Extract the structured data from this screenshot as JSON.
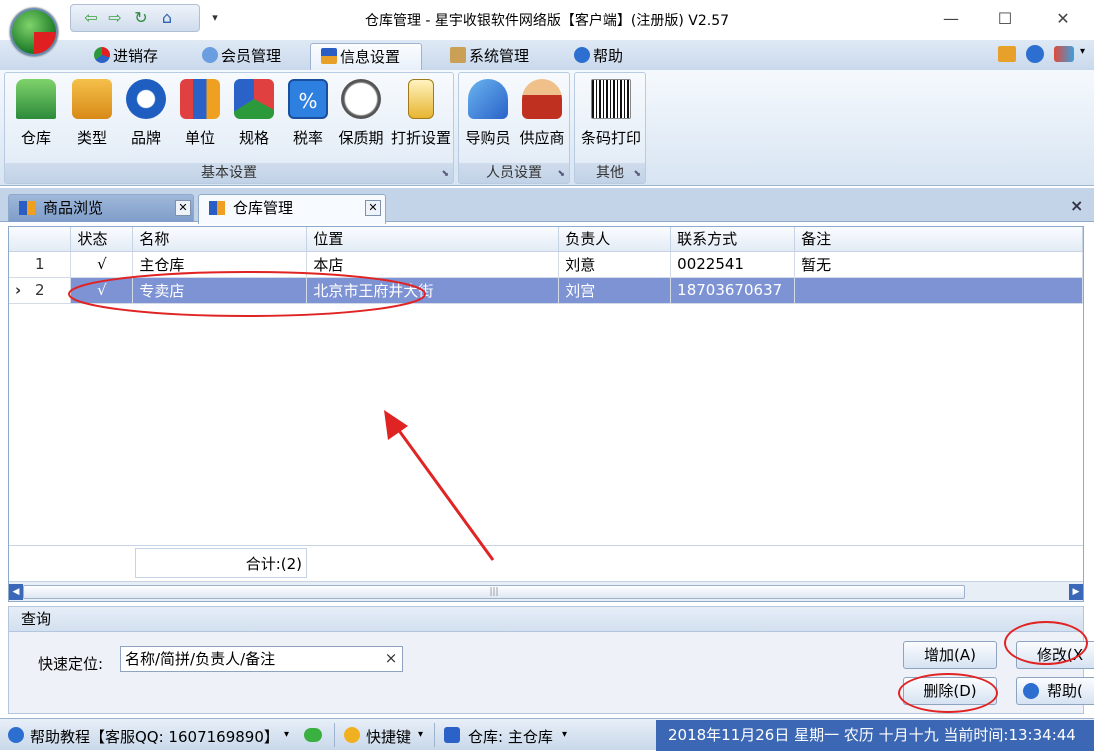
{
  "window": {
    "title": "仓库管理 - 星宇收银软件网络版【客户端】(注册版) V2.57",
    "controls": [
      "—",
      "☐",
      "✕"
    ]
  },
  "quick_access": [
    "⇦",
    "⇨",
    "↻",
    "⌂",
    "▾"
  ],
  "ribbon_tabs": [
    {
      "label": "进销存",
      "icon": "pie-chart-icon"
    },
    {
      "label": "会员管理",
      "icon": "members-icon"
    },
    {
      "label": "信息设置",
      "icon": "info-settings-icon",
      "active": true
    },
    {
      "label": "系统管理",
      "icon": "tools-icon"
    },
    {
      "label": "帮助",
      "icon": "help-icon"
    }
  ],
  "ribbon_right_icons": [
    "cart-icon",
    "help-icon",
    "theme-icon",
    "▾"
  ],
  "ribbon_groups": {
    "basic": {
      "label": "基本设置",
      "buttons": [
        "仓库",
        "类型",
        "品牌",
        "单位",
        "规格",
        "税率",
        "保质期",
        "打折设置"
      ]
    },
    "people": {
      "label": "人员设置",
      "buttons": [
        "导购员",
        "供应商"
      ]
    },
    "other": {
      "label": "其他",
      "buttons": [
        "条码打印"
      ]
    }
  },
  "doc_tabs": [
    {
      "label": "商品浏览",
      "active": false
    },
    {
      "label": "仓库管理",
      "active": true
    }
  ],
  "doc_close_all": "×",
  "grid": {
    "columns": [
      "状态",
      "名称",
      "位置",
      "负责人",
      "联系方式",
      "备注"
    ],
    "rows": [
      {
        "index": "1",
        "marker": "",
        "status": "√",
        "name": "主仓库",
        "location": "本店",
        "manager": "刘意",
        "contact": "0022541",
        "note": "暂无"
      },
      {
        "index": "2",
        "marker": "›",
        "status": "√",
        "name": "专卖店",
        "location": "北京市王府井大街",
        "manager": "刘宫",
        "contact": "18703670637",
        "note": ""
      }
    ],
    "summary": "合计:(2)",
    "scroll_left": "◀",
    "scroll_right": "▶",
    "scroll_grip": "|||"
  },
  "query": {
    "header": "查询",
    "label": "快速定位:",
    "placeholder": "名称/简拼/负责人/备注",
    "clear": "×",
    "buttons": {
      "add": "增加(A)",
      "edit": "修改(X",
      "delete": "删除(D)",
      "help": "帮助("
    }
  },
  "status_bar": {
    "help": "帮助教程【客服QQ: 1607169890】",
    "shortcut": "快捷键",
    "warehouse": "仓库: 主仓库",
    "datetime": "2018年11月26日 星期一 农历 十月十九 当前时间:13:34:44"
  },
  "colors": {
    "selected_row": "#7e93d4",
    "ribbon_bg": "#d7e4f2",
    "status_right": "#3b67b4",
    "annotation": "#e02424"
  }
}
